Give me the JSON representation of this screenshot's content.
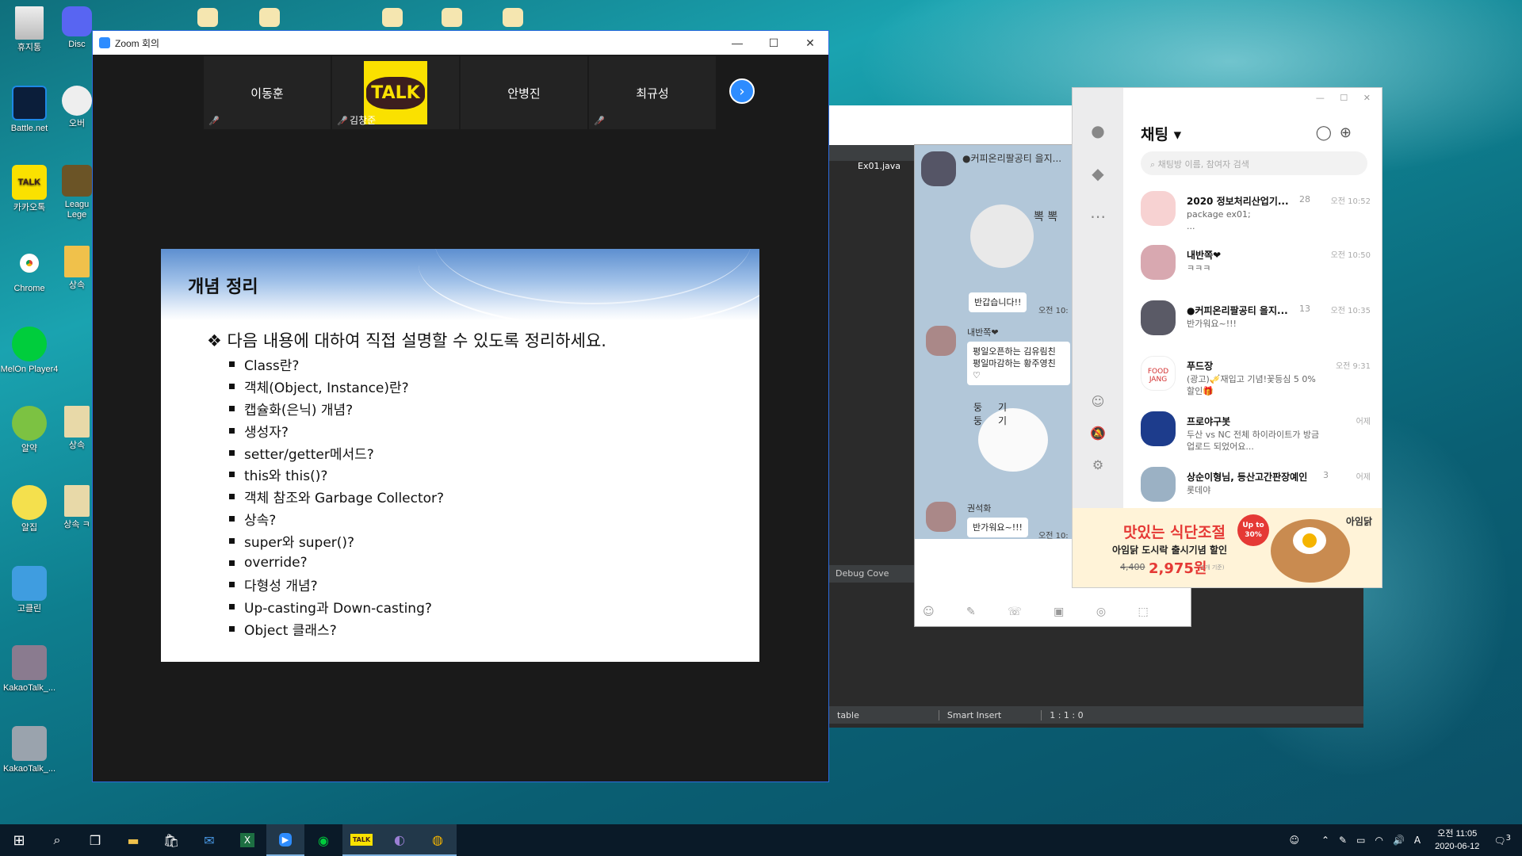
{
  "desktop": {
    "icons": [
      {
        "label": "휴지통"
      },
      {
        "label": "Disc"
      },
      {
        "label": "Battle.net"
      },
      {
        "label": "오버"
      },
      {
        "label": "카카오톡"
      },
      {
        "label": "Leagu Lege"
      },
      {
        "label": "Chrome"
      },
      {
        "label": "상속"
      },
      {
        "label": "MelOn Player4"
      },
      {
        "label": "알약"
      },
      {
        "label": "상속"
      },
      {
        "label": "알집"
      },
      {
        "label": "상속 ㅋ"
      },
      {
        "label": "고클린"
      },
      {
        "label": "KakaoTalk_..."
      },
      {
        "label": "KakaoTalk_..."
      }
    ]
  },
  "zoom": {
    "title": "Zoom 회의",
    "controls": {
      "minimize": "—",
      "maximize": "☐",
      "close": "✕"
    },
    "participants": [
      {
        "name": "이동훈",
        "label": ""
      },
      {
        "name": "",
        "label": "김창준",
        "avatar": "TALK"
      },
      {
        "name": "안병진",
        "label": ""
      },
      {
        "name": "최규성",
        "label": ""
      }
    ],
    "slide": {
      "title": "개념 정리",
      "lead": "❖ 다음 내용에 대하여 직접 설명할 수 있도록 정리하세요.",
      "items": [
        "Class란?",
        "객체(Object, Instance)란?",
        "캡슐화(은닉) 개념?",
        "생성자?",
        "setter/getter메서드?",
        "this와 this()?",
        "객체 참조와 Garbage Collector?",
        "상속?",
        "super와 super()?",
        "override?",
        "다형성 개념?",
        "Up-casting과 Down-casting?",
        "Object 클래스?"
      ]
    }
  },
  "eclipse": {
    "tab": "Ex01.java",
    "bottom_tabs": "Debug  Cove",
    "status": {
      "mode": "table",
      "insert": "Smart Insert",
      "position": "1 : 1 : 0"
    }
  },
  "chatroom": {
    "title": "●커피온리팔공티 을지...",
    "messages": [
      {
        "sender": "",
        "text": "반갑습니다!!",
        "time": "오전 10:"
      },
      {
        "sender": "내반쪽❤",
        "text": "평일오픈하는 김유림친 평일마감하는 황주영친 ♡",
        "time": ""
      },
      {
        "sender": "권석화",
        "text": "반가워요~!!!",
        "time": "오전 10:"
      }
    ],
    "sticker_text_1": "뽁 뽁",
    "sticker_text_2": "둥기 둥기"
  },
  "kakao": {
    "title": "채팅 ▾",
    "search_placeholder": "채팅방 이름, 참여자 검색",
    "window_controls": "— ☐ ✕",
    "chats": [
      {
        "name": "2020 정보처리산업기...",
        "count": "28",
        "time": "오전 10:52",
        "preview": "package ex01;\n..."
      },
      {
        "name": "내반쪽❤",
        "count": "",
        "time": "오전 10:50",
        "preview": "ㅋㅋㅋ"
      },
      {
        "name": "●커피온리팔공티 을지...",
        "count": "13",
        "time": "오전 10:35",
        "preview": "반가워요~!!!"
      },
      {
        "name": "푸드장",
        "count": "",
        "time": "오전 9:31",
        "preview": "(광고)🎺재입고 기념!꽃등심 5 0%할인🎁"
      },
      {
        "name": "프로야구봇",
        "count": "",
        "time": "어제",
        "preview": "두산 vs NC 전체 하이라이트가 방금 업로드 되었어요..."
      },
      {
        "name": "상순이형님, 등산고간판장예인",
        "count": "3",
        "time": "어제",
        "preview": "롯데야"
      }
    ],
    "ad": {
      "headline": "맛있는 식단조절",
      "sub": "아임닭 도시락 출시기념 할인",
      "old_price": "4,400",
      "price": "2,975원",
      "unit": "(1개 기준)",
      "badge": "Up to 30%",
      "brand": "아임닭"
    }
  },
  "taskbar": {
    "clock_time": "오전 11:05",
    "clock_date": "2020-06-12",
    "notification_count": "3",
    "ime": "A"
  }
}
